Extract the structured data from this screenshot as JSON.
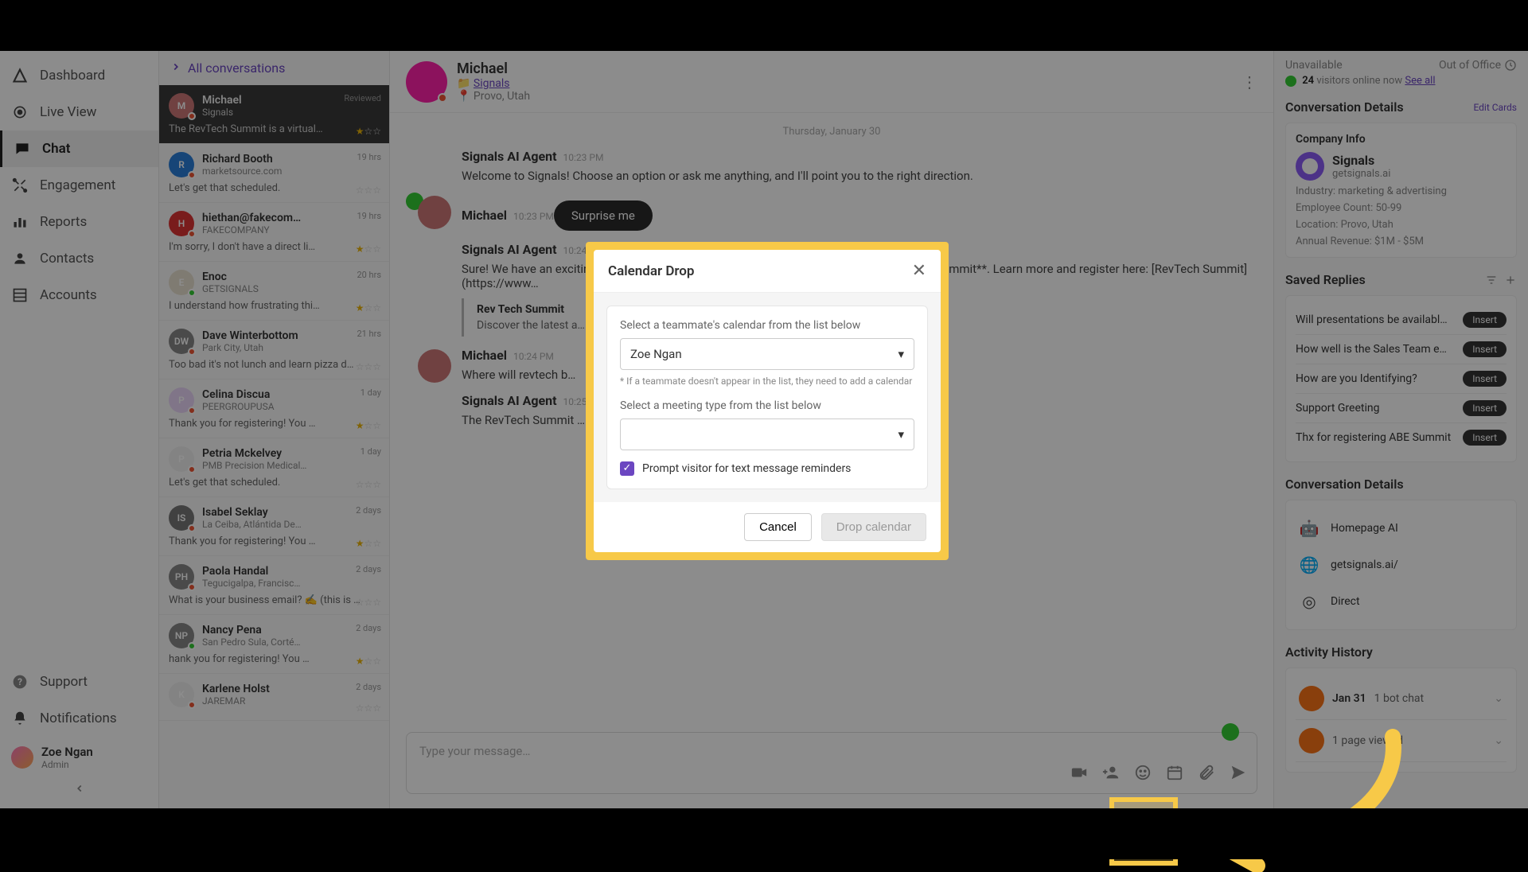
{
  "nav": {
    "items": [
      {
        "label": "Dashboard",
        "icon": "◬"
      },
      {
        "label": "Live View",
        "icon": "◉"
      },
      {
        "label": "Chat",
        "icon": "▮"
      },
      {
        "label": "Engagement",
        "icon": "✦"
      },
      {
        "label": "Reports",
        "icon": "▮▮"
      },
      {
        "label": "Contacts",
        "icon": "◉"
      },
      {
        "label": "Accounts",
        "icon": "▥"
      }
    ],
    "footer": [
      {
        "label": "Support",
        "icon": "?"
      },
      {
        "label": "Notifications",
        "icon": "🔔"
      }
    ],
    "user": {
      "name": "Zoe Ngan",
      "role": "Admin"
    }
  },
  "convlist": {
    "title": "All conversations",
    "items": [
      {
        "name": "Michael",
        "sub": "Signals",
        "preview": "The RevTech Summit is a virtual…",
        "time": "Reviewed",
        "stars": 1,
        "selected": true,
        "av": "M",
        "avcolor": "#c77"
      },
      {
        "name": "Richard Booth",
        "sub": "marketsource.com",
        "preview": "Let's get that scheduled.",
        "time": "19 hrs",
        "stars": 0,
        "av": "R",
        "avcolor": "#2b7fd9"
      },
      {
        "name": "hiethan@fakecom…",
        "sub": "FAKECOMPANY",
        "preview": "I'm sorry, I don't have a direct li…",
        "time": "19 hrs",
        "stars": 1,
        "av": "H",
        "avcolor": "#d33"
      },
      {
        "name": "Enoc",
        "sub": "GETSIGNALS",
        "preview": "I understand how frustrating thi…",
        "time": "20 hrs",
        "stars": 1,
        "av": "E",
        "avcolor": "#e8e0d0",
        "green": true
      },
      {
        "name": "Dave Winterbottom",
        "sub": "Park City, Utah",
        "preview": "Too bad it's not lunch and learn pizza d…",
        "time": "21 hrs",
        "stars": 0,
        "av": "DW",
        "avcolor": "#888"
      },
      {
        "name": "Celina Discua",
        "sub": "PEERGROUPUSA",
        "preview": "Thank you for registering! You …",
        "time": "1 day",
        "stars": 1,
        "av": "P",
        "avcolor": "#e9d5f7"
      },
      {
        "name": "Petria Mckelvey",
        "sub": "PMB Precision Medical…",
        "preview": "Let's get that scheduled.",
        "time": "1 day",
        "stars": 0,
        "av": "P",
        "avcolor": "#eee"
      },
      {
        "name": "Isabel Seklay",
        "sub": "La Ceiba, Atlántida De…",
        "preview": "Thank you for registering! You …",
        "time": "2 days",
        "stars": 1,
        "av": "IS",
        "avcolor": "#777"
      },
      {
        "name": "Paola Handal",
        "sub": "Tegucigalpa, Francisc…",
        "preview": "What is your business email? ✍️ (this is …",
        "time": "2 days",
        "stars": 0,
        "av": "PH",
        "avcolor": "#888"
      },
      {
        "name": "Nancy Pena",
        "sub": "San Pedro Sula, Corté…",
        "preview": "hank you for registering! You …",
        "time": "2 days",
        "stars": 1,
        "av": "NP",
        "avcolor": "#888",
        "green": true
      },
      {
        "name": "Karlene Holst",
        "sub": "JAREMAR",
        "preview": "",
        "time": "2 days",
        "stars": 0,
        "av": "K",
        "avcolor": "#eee"
      }
    ]
  },
  "chat": {
    "header": {
      "name": "Michael",
      "link": "Signals",
      "loc": "Provo, Utah"
    },
    "date": "Thursday, January 30",
    "messages": [
      {
        "sender": "Signals AI Agent",
        "ts": "10:23 PM",
        "body": "Welcome to Signals! Choose an option or ask me anything, and I'll point you to the right direction.",
        "av": ""
      },
      {
        "sender": "Michael",
        "ts": "10:23 PM",
        "body": "",
        "pill": "Surprise me",
        "av": "m"
      },
      {
        "sender": "Signals AI Agent",
        "ts": "10:24 PM",
        "body": "Sure! We have an exciting event coming up that you might be interested in: the **RevTech Summit**. Learn more and register here: [RevTech Summit](https://www…",
        "quote": {
          "title": "Rev Tech Summit",
          "body": "Discover the latest a…"
        }
      },
      {
        "sender": "Michael",
        "ts": "10:24 PM",
        "body": "Where will revtech b…",
        "av": "m"
      },
      {
        "sender": "Signals AI Agent",
        "ts": "10:25 PM",
        "body": "The RevTech Summit … Let me know if you'd like more details!"
      }
    ],
    "composer": {
      "placeholder": "Type your message…"
    }
  },
  "rpanel": {
    "status": "Unavailable",
    "out": "Out of Office",
    "visitors": {
      "n": "24",
      "txt": "visitors online now",
      "all": "See all"
    },
    "section_conv": "Conversation Details",
    "edit": "Edit Cards",
    "company": {
      "title": "Company Info",
      "name": "Signals",
      "domain": "getsignals.ai",
      "industry": "Industry: marketing & advertising",
      "emp": "Employee Count: 50-99",
      "loc": "Location: Provo, Utah",
      "rev": "Annual Revenue: $1M - $5M"
    },
    "saved": {
      "title": "Saved Replies",
      "items": [
        "Will presentations be availabl…",
        "How well is the Sales Team e…",
        "How are you Identifying?",
        "Support Greeting",
        "Thx for registering ABE Summit"
      ],
      "insert": "Insert"
    },
    "details": {
      "title": "Conversation Details",
      "rows": [
        {
          "icon": "🤖",
          "label": "Homepage AI"
        },
        {
          "icon": "🌐",
          "label": "getsignals.ai/"
        },
        {
          "icon": "◎",
          "label": "Direct"
        }
      ]
    },
    "activity": {
      "title": "Activity History",
      "rows": [
        {
          "date": "Jan 31",
          "txt": "1 bot chat"
        },
        {
          "date": "",
          "txt": "1 page viewed"
        }
      ]
    }
  },
  "modal": {
    "title": "Calendar Drop",
    "label1": "Select a teammate's calendar from the list below",
    "selected": "Zoe Ngan",
    "hint": "* If a teammate doesn't appear in the list, they need to add a calendar",
    "label2": "Select a meeting type from the list below",
    "checkbox": "Prompt visitor for text message reminders",
    "cancel": "Cancel",
    "drop": "Drop calendar"
  }
}
